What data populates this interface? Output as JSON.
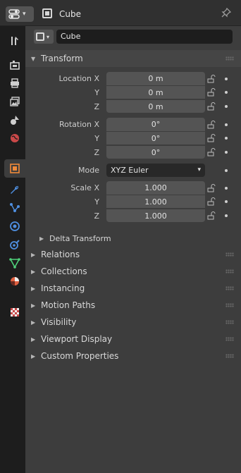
{
  "header": {
    "editor_icon": "properties-editor-icon",
    "title": "Cube",
    "pin_icon": "pin-icon"
  },
  "tabs": [
    {
      "name": "tool-tab",
      "icon": "tool-icon",
      "color": "#cfcfcf"
    },
    {
      "name": "render-tab",
      "icon": "render-icon",
      "color": "#cfcfcf"
    },
    {
      "name": "output-tab",
      "icon": "output-icon",
      "color": "#cfcfcf"
    },
    {
      "name": "view-layer-tab",
      "icon": "view-layer-icon",
      "color": "#cfcfcf"
    },
    {
      "name": "scene-tab",
      "icon": "scene-icon",
      "color": "#cfcfcf"
    },
    {
      "name": "world-tab",
      "icon": "world-icon",
      "color": "#e05050"
    },
    {
      "name": "object-tab",
      "icon": "object-icon",
      "color": "#f08a3a",
      "active": true
    },
    {
      "name": "modifiers-tab",
      "icon": "wrench-icon",
      "color": "#4f8fe0"
    },
    {
      "name": "particles-tab",
      "icon": "particles-icon",
      "color": "#4f8fe0"
    },
    {
      "name": "physics-tab",
      "icon": "physics-icon",
      "color": "#4f8fe0"
    },
    {
      "name": "constraints-tab",
      "icon": "constraints-icon",
      "color": "#4f8fe0"
    },
    {
      "name": "data-tab",
      "icon": "mesh-data-icon",
      "color": "#4fd07a"
    },
    {
      "name": "material-tab",
      "icon": "material-icon",
      "color": "#e06040"
    },
    {
      "name": "texture-tab",
      "icon": "texture-icon",
      "color": "#e05050"
    }
  ],
  "object_name": "Cube",
  "transform": {
    "title": "Transform",
    "location_label": "Location X",
    "y_label": "Y",
    "z_label": "Z",
    "location": [
      "0 m",
      "0 m",
      "0 m"
    ],
    "rotation_label": "Rotation X",
    "rotation": [
      "0°",
      "0°",
      "0°"
    ],
    "mode_label": "Mode",
    "mode_value": "XYZ Euler",
    "scale_label": "Scale X",
    "scale": [
      "1.000",
      "1.000",
      "1.000"
    ],
    "delta": "Delta Transform"
  },
  "panels": [
    "Relations",
    "Collections",
    "Instancing",
    "Motion Paths",
    "Visibility",
    "Viewport Display",
    "Custom Properties"
  ],
  "colors": {
    "panel_bg": "#3d3d3d",
    "field_bg": "#545454",
    "sidebar_bg": "#1d1d1d"
  }
}
